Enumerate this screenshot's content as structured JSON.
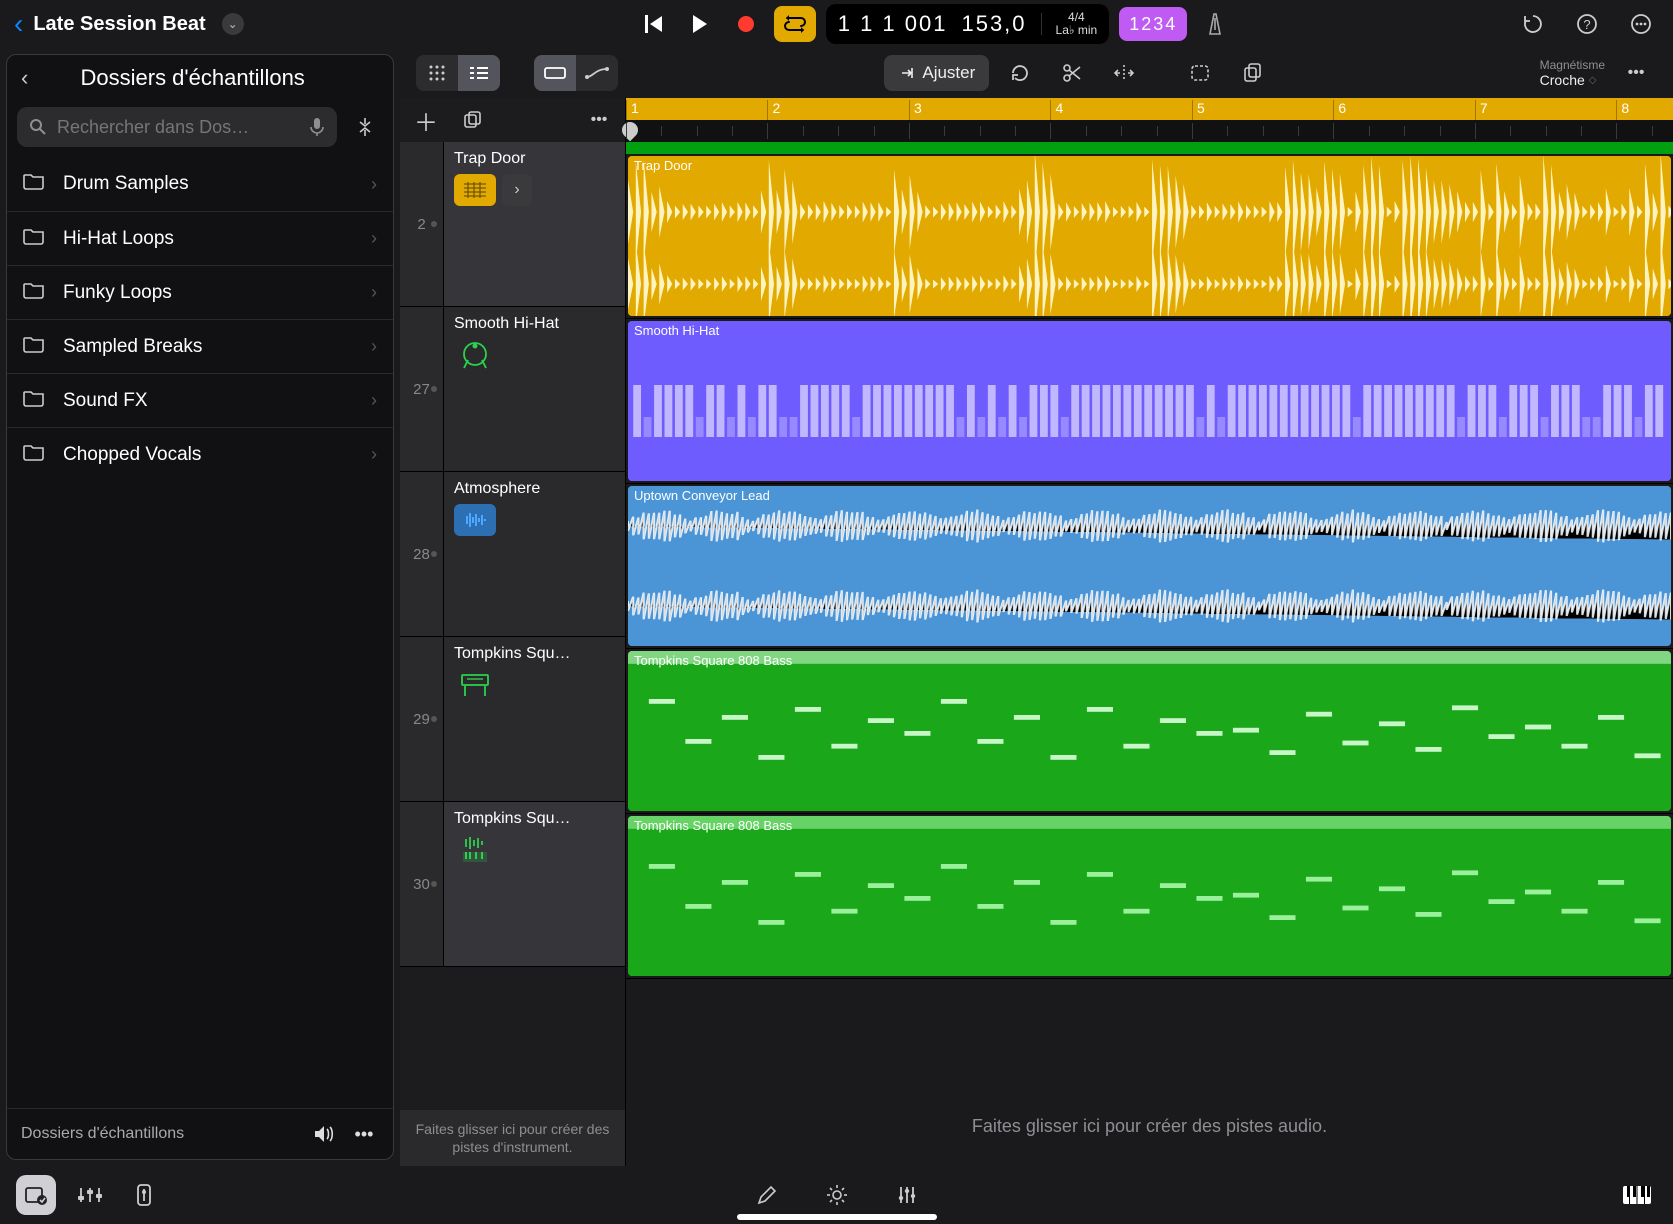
{
  "project": {
    "title": "Late Session Beat"
  },
  "transport": {
    "position": "1 1 1 001",
    "tempo": "153,0",
    "sig": "4/4",
    "key": "La♭ min",
    "count": "1234"
  },
  "sidebar": {
    "title": "Dossiers d'échantillons",
    "search_placeholder": "Rechercher dans Dos…",
    "footer_label": "Dossiers d'échantillons",
    "folders": [
      {
        "label": "Drum Samples"
      },
      {
        "label": "Hi-Hat Loops"
      },
      {
        "label": "Funky Loops"
      },
      {
        "label": "Sampled Breaks"
      },
      {
        "label": "Sound FX"
      },
      {
        "label": "Chopped Vocals"
      }
    ]
  },
  "toolbar": {
    "adjust_label": "Ajuster",
    "snap_title": "Magnétisme",
    "snap_value": "Croche"
  },
  "ruler": {
    "bars": [
      "1",
      "2",
      "3",
      "4",
      "5",
      "6",
      "7",
      "8"
    ]
  },
  "tracks": [
    {
      "num": "2",
      "name": "Trap Door",
      "region": "Trap Door",
      "color": "#e2a900",
      "icon": "sampler",
      "sel": true,
      "expand": true
    },
    {
      "num": "27",
      "name": "Smooth Hi-Hat",
      "region": "Smooth Hi-Hat",
      "color": "#6e5cff",
      "icon": "drummer",
      "sel": false,
      "expand": false
    },
    {
      "num": "28",
      "name": "Atmosphere",
      "region": "Uptown Conveyor Lead",
      "color": "#4b95d6",
      "icon": "audio",
      "sel": false,
      "expand": false
    },
    {
      "num": "29",
      "name": "Tompkins Squ…",
      "region": "Tompkins Square 808 Bass",
      "color": "#1aa81a",
      "icon": "keys",
      "sel": false,
      "expand": false
    },
    {
      "num": "30",
      "name": "Tompkins Squ…",
      "region": "Tompkins Square 808 Bass",
      "color": "#1aa81a",
      "icon": "stems",
      "sel": true,
      "expand": false
    }
  ],
  "hints": {
    "instrument_drop": "Faites glisser ici pour créer des pistes d'instrument.",
    "audio_drop": "Faites glisser ici pour créer des pistes audio."
  }
}
